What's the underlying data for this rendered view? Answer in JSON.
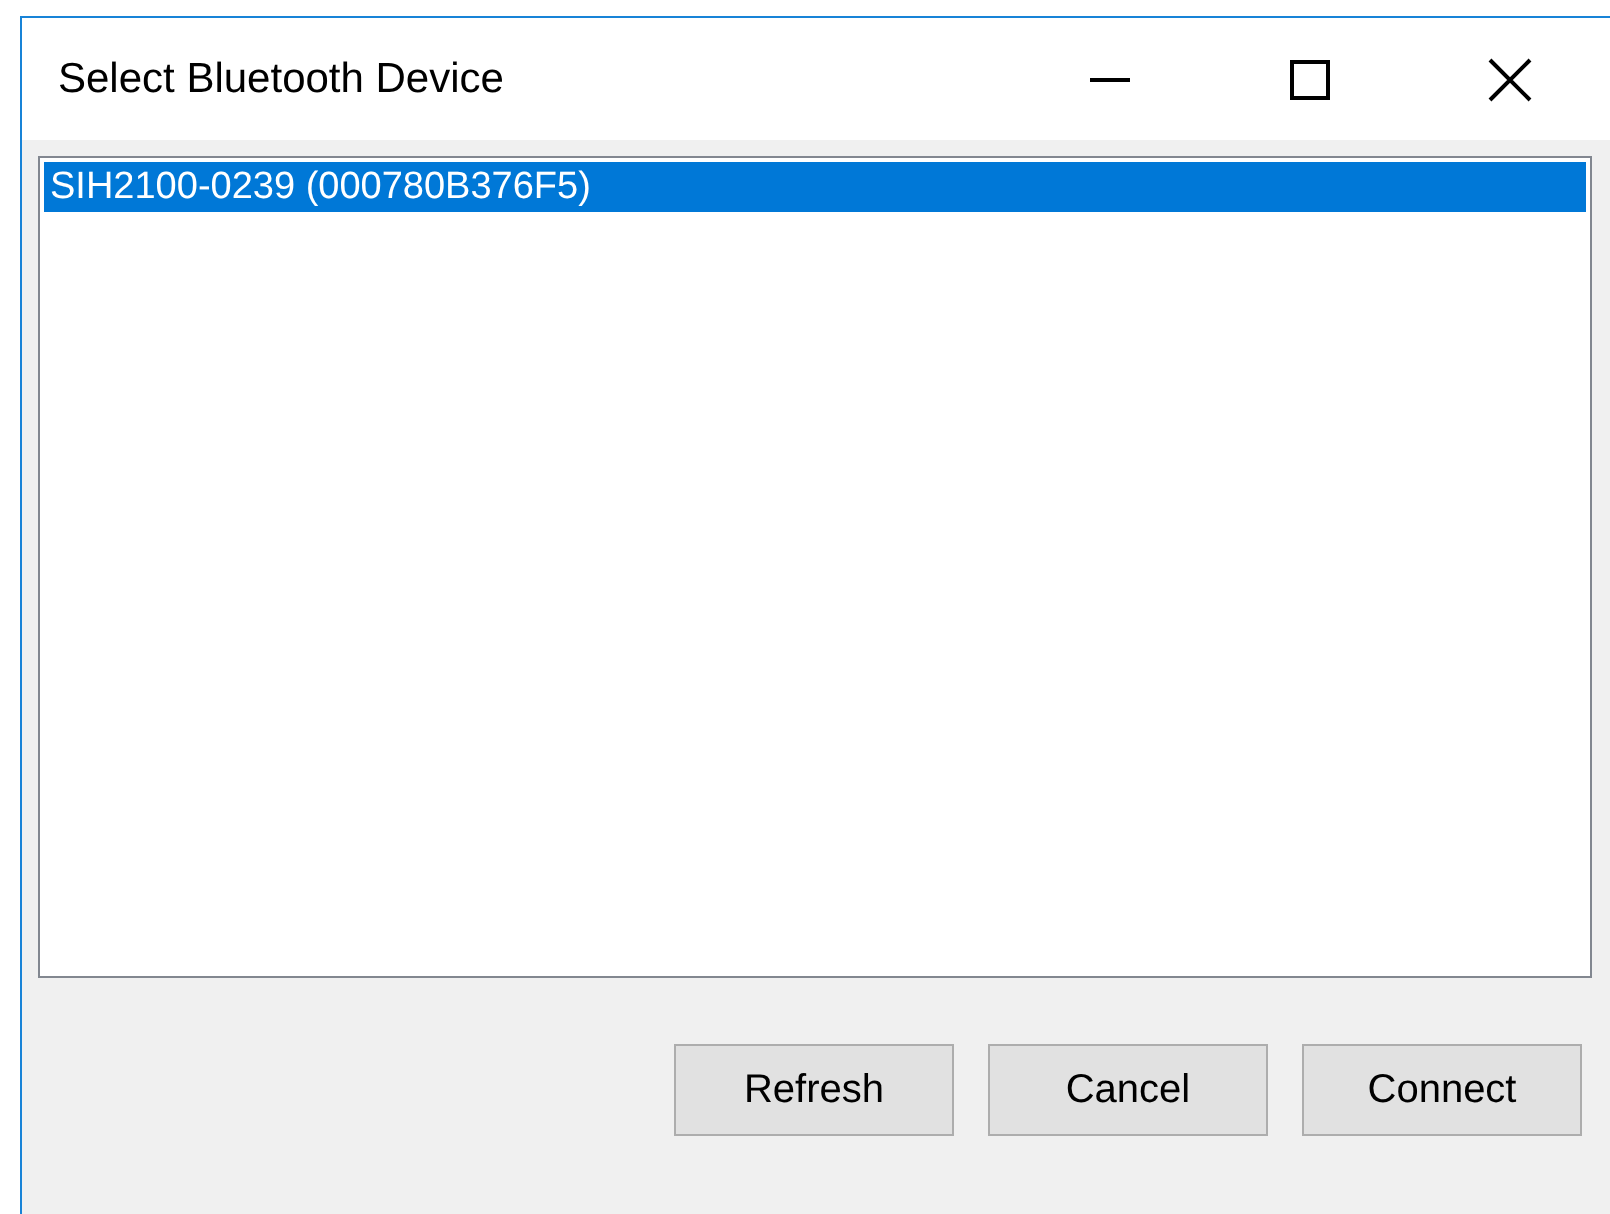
{
  "window": {
    "title": "Select Bluetooth Device",
    "controls": [
      {
        "kind": "minimize"
      },
      {
        "kind": "maximize"
      },
      {
        "kind": "close"
      }
    ]
  },
  "devices": [
    {
      "label": "SIH2100-0239 (000780B376F5)",
      "selected": true
    }
  ],
  "buttons": [
    "Refresh",
    "Cancel",
    "Connect"
  ]
}
